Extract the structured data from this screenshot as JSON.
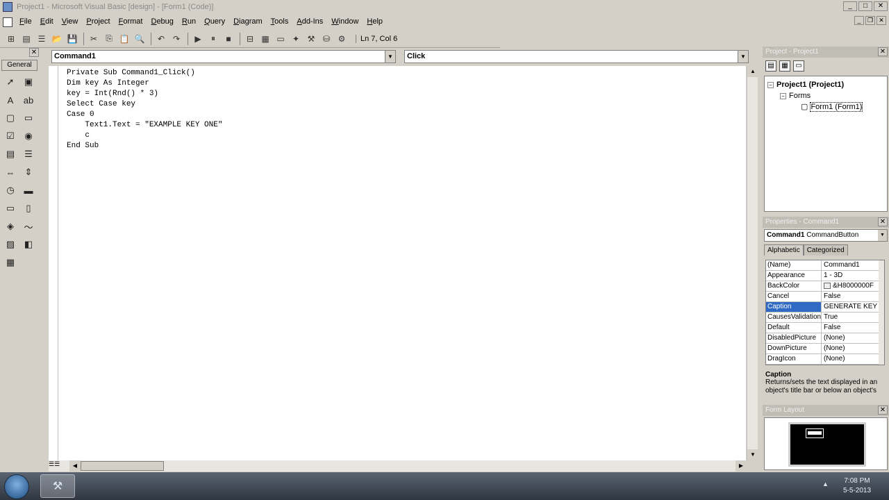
{
  "window": {
    "title": "Project1 - Microsoft Visual Basic [design] - [Form1 (Code)]",
    "min": "_",
    "max": "□",
    "close": "✕"
  },
  "menu": {
    "items": [
      "File",
      "Edit",
      "View",
      "Project",
      "Format",
      "Debug",
      "Run",
      "Query",
      "Diagram",
      "Tools",
      "Add-Ins",
      "Window",
      "Help"
    ],
    "mdi_min": "_",
    "mdi_restore": "❐",
    "mdi_close": "✕"
  },
  "toolbar": {
    "cursor_position": "Ln 7, Col 6"
  },
  "toolbox": {
    "tab_label": "General",
    "close": "✕",
    "tools": [
      "pointer-icon",
      "picturebox-icon",
      "label-icon",
      "textbox-icon",
      "frame-icon",
      "commandbutton-icon",
      "checkbox-icon",
      "optionbutton-icon",
      "combobox-icon",
      "listbox-icon",
      "hscrollbar-icon",
      "vscrollbar-icon",
      "timer-icon",
      "drivelistbox-icon",
      "dirlistbox-icon",
      "filelistbox-icon",
      "shape-icon",
      "line-icon",
      "image-icon",
      "data-icon",
      "ole-icon"
    ]
  },
  "code_window": {
    "object_combo": "Command1",
    "procedure_combo": "Click",
    "lines": [
      "Private Sub Command1_Click()",
      "Dim key As Integer",
      "key = Int(Rnd() * 3)",
      "Select Case key",
      "Case 0",
      "    Text1.Text = \"EXAMPLE KEY ONE\"",
      "    c",
      "End Sub"
    ]
  },
  "project_panel": {
    "title": "Project - Project1",
    "close": "✕",
    "root": "Project1 (Project1)",
    "folder": "Forms",
    "form": "Form1 (Form1)"
  },
  "properties_panel": {
    "title": "Properties - Command1",
    "close": "✕",
    "object_name": "Command1",
    "object_type": "CommandButton",
    "tabs": [
      "Alphabetic",
      "Categorized"
    ],
    "rows": [
      {
        "name": "(Name)",
        "value": "Command1"
      },
      {
        "name": "Appearance",
        "value": "1 - 3D"
      },
      {
        "name": "BackColor",
        "value": "&H8000000F"
      },
      {
        "name": "Cancel",
        "value": "False"
      },
      {
        "name": "Caption",
        "value": "GENERATE KEY"
      },
      {
        "name": "CausesValidation",
        "value": "True"
      },
      {
        "name": "Default",
        "value": "False"
      },
      {
        "name": "DisabledPicture",
        "value": "(None)"
      },
      {
        "name": "DownPicture",
        "value": "(None)"
      },
      {
        "name": "DragIcon",
        "value": "(None)"
      }
    ],
    "selected_index": 4,
    "desc_title": "Caption",
    "desc_text": "Returns/sets the text displayed in an object's title bar or below an object's"
  },
  "layout_panel": {
    "title": "Form Layout",
    "close": "✕"
  },
  "taskbar": {
    "time": "7:08 PM",
    "date": "5-5-2013"
  }
}
